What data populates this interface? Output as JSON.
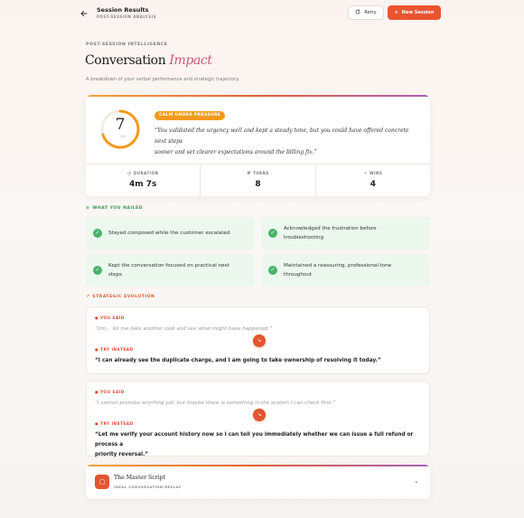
{
  "header": {
    "title": "Session Results",
    "subtitle": "POST-SESSION ANALYSIS",
    "retry_label": "Retry",
    "new_session_label": "New Session",
    "accent_color": "#ea5430"
  },
  "intro": {
    "eyebrow": "POST-SESSION INTELLIGENCE",
    "title_main": "Conversation",
    "title_accent": "Impact",
    "lede": "A breakdown of your verbal performance and strategic trajectory."
  },
  "summary": {
    "score": "7",
    "score_max": "/10",
    "score_fraction": 0.7,
    "badge": "CALM UNDER PRESSURE",
    "quote_line1": "“You validated the urgency well and kept a steady tone, but you could have offered concrete next steps",
    "quote_line2": "sooner and set clearer expectations around the billing fix.”",
    "stats": [
      {
        "icon": "clock-icon",
        "label": "DURATION",
        "value": "4m 7s"
      },
      {
        "icon": "hash-icon",
        "label": "TURNS",
        "value": "8"
      },
      {
        "icon": "sparkle-icon",
        "label": "WINS",
        "value": "4"
      }
    ]
  },
  "nailed": {
    "heading": "WHAT YOU NAILED",
    "items": [
      {
        "line1": "Stayed composed while the customer escalated",
        "line2": ""
      },
      {
        "line1": "Acknowledged the frustration before",
        "line2": "troubleshooting"
      },
      {
        "line1": "Kept the conversation focused on practical next",
        "line2": "steps"
      },
      {
        "line1": "Maintained a reassuring, professional tone",
        "line2": "throughout"
      }
    ]
  },
  "evolution": {
    "heading": "STRATEGIC EVOLUTION",
    "said_label": "YOU SAID",
    "try_label": "TRY INSTEAD",
    "items": [
      {
        "said": "“Um... let me take another look and see what might have happened.”",
        "try_line1": "“I can already see the duplicate charge, and I am going to take ownership of resolving it today.”",
        "try_line2": ""
      },
      {
        "said": "“I cannot promise anything yet, but maybe there is something in the system I can check first.”",
        "try_line1": "“Let me verify your account history now so I can tell you immediately whether we can issue a full refund or process a",
        "try_line2": "priority reversal.”"
      }
    ]
  },
  "master": {
    "title": "The Master Script",
    "subtitle": "IDEAL CONVERSATION REPLAY"
  }
}
